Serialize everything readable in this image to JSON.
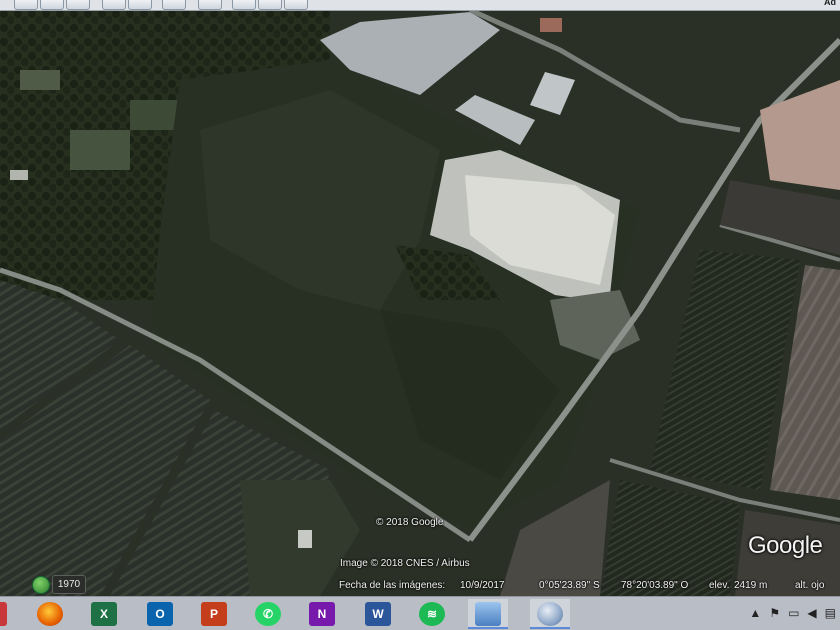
{
  "toolbar": {
    "label": "Ad"
  },
  "map": {
    "copyright_google": "© 2018 Google",
    "copyright_imagery": "Image © 2018 CNES / Airbus",
    "logo": "Google",
    "timeline_year": "1970",
    "status": {
      "date_label": "Fecha de las imágenes:",
      "date_value": "10/9/2017",
      "latitude": "0°05'23.89\" S",
      "longitude": "78°20'03.89\" O",
      "elevation_label": "elev.",
      "elevation_value": "2419 m",
      "altitude_label": "alt. ojo"
    }
  },
  "taskbar": {
    "apps": [
      {
        "name": "firefox",
        "icon": "firefox-icon",
        "color": "#e66000"
      },
      {
        "name": "excel",
        "icon": "excel-icon",
        "color": "#1e7145",
        "letter": "X"
      },
      {
        "name": "outlook",
        "icon": "outlook-icon",
        "color": "#0a64ad",
        "letter": "O"
      },
      {
        "name": "powerpoint",
        "icon": "powerpoint-icon",
        "color": "#c43e1c",
        "letter": "P"
      },
      {
        "name": "whatsapp",
        "icon": "whatsapp-icon",
        "color": "#25d366"
      },
      {
        "name": "onenote",
        "icon": "onenote-icon",
        "color": "#7719aa",
        "letter": "N"
      },
      {
        "name": "word",
        "icon": "word-icon",
        "color": "#2b579a",
        "letter": "W"
      },
      {
        "name": "spotify",
        "icon": "spotify-icon",
        "color": "#1db954"
      },
      {
        "name": "image-viewer",
        "icon": "photo-viewer-icon",
        "color": "#5a88c8"
      },
      {
        "name": "google-earth-pro",
        "icon": "google-earth-icon",
        "color": "#3b6ea8"
      }
    ]
  }
}
